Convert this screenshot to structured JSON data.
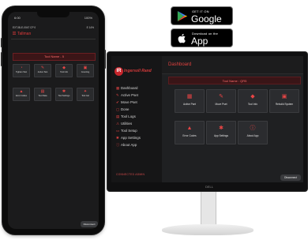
{
  "stores": {
    "google": {
      "top_text": "GET IT ON",
      "name": "Google Play"
    },
    "apple": {
      "top_text": "Download on the",
      "name": "App Store"
    }
  },
  "phone": {
    "time": "6:00",
    "battery": "100%",
    "device_line": "EXT-BLE-0047 CP 0",
    "device_right": "E 14%",
    "title": "Tallman",
    "banner": "Tool Name - 5",
    "tiles": [
      {
        "icon": "gauge-icon",
        "label": "Tighten Test"
      },
      {
        "icon": "wrench-icon",
        "label": "Active Test"
      },
      {
        "icon": "tool-info-icon",
        "label": "Tool Info"
      },
      {
        "icon": "counter-icon",
        "label": "Counting"
      },
      {
        "icon": "error-icon",
        "label": "Error Codes"
      },
      {
        "icon": "log-icon",
        "label": "Tool Data"
      },
      {
        "icon": "settings-icon",
        "label": "Tool Settings"
      },
      {
        "icon": "spanner-icon",
        "label": "Tool Cal"
      }
    ],
    "disconnect": "Disconnect"
  },
  "desktop": {
    "brand": "Ingersoll Rand",
    "page_title": "Dashboard",
    "banner": "Tool Name : QR5",
    "nav": [
      {
        "icon": "dashboard-icon",
        "label": "Dashboard"
      },
      {
        "icon": "active-pset-icon",
        "label": "Active Pset"
      },
      {
        "icon": "move-pset-icon",
        "label": "Move Pset"
      },
      {
        "icon": "done-icon",
        "label": "Done"
      },
      {
        "icon": "tool-logs-icon",
        "label": "Tool Logs"
      },
      {
        "icon": "utilities-icon",
        "label": "Utilities"
      },
      {
        "icon": "tool-setup-icon",
        "label": "Tool Setup"
      },
      {
        "icon": "app-settings-icon",
        "label": "App Settings"
      },
      {
        "icon": "about-icon",
        "label": "About App"
      }
    ],
    "tiles": [
      {
        "icon": "active-pset-icon",
        "label": "Active Pset"
      },
      {
        "icon": "move-pset-icon",
        "label": "Move Pset"
      },
      {
        "icon": "tool-info-icon",
        "label": "Tool Info"
      },
      {
        "icon": "rebuild-icon",
        "label": "Rebuild System"
      },
      {
        "icon": "error-icon",
        "label": "Error Codes"
      },
      {
        "icon": "settings-icon",
        "label": "App Settings"
      },
      {
        "icon": "about-icon",
        "label": "About App"
      }
    ],
    "footer": "CONNECTED ADMIN",
    "disconnect": "Disconnect",
    "monitor_brand": "DELL"
  }
}
